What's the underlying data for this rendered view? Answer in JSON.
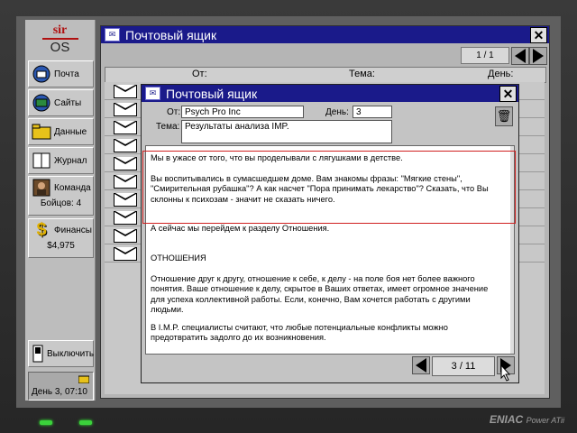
{
  "logo": {
    "top": "sir",
    "bottom": "OS"
  },
  "sidebar": {
    "mail": "Почта",
    "sites": "Сайты",
    "data": "Данные",
    "journal": "Журнал",
    "team": "Команда",
    "fighters": "Бойцов: 4",
    "finance": "Финансы",
    "money": "$4,975",
    "shutdown": "Выключить",
    "clock": "День 3, 07:10"
  },
  "mailbox": {
    "title": "Почтовый ящик",
    "page": "1 / 1",
    "col_from": "От:",
    "col_subject": "Тема:",
    "col_day": "День:"
  },
  "message": {
    "title": "Почтовый ящик",
    "from_label": "От:",
    "from_value": "Psych Pro Inc",
    "day_label": "День:",
    "day_value": "3",
    "subject_label": "Тема:",
    "subject_value": "Результаты анализа IMP.",
    "paragraphs": [
      "Мы в ужасе от того, что вы проделывали с лягушками в детстве.",
      "Вы воспитывались в сумасшедшем доме. Вам знакомы фразы: \"Мягкие стены\", \"Смирительная рубашка\"? А как насчет \"Пора принимать лекарство\"? Сказать, что Вы склонны к психозам - значит не сказать ничего.",
      "А сейчас мы перейдем к разделу Отношения.",
      "ОТНОШЕНИЯ",
      "Отношение друг к другу, отношение к себе, к делу - на поле боя нет более важного понятия. Ваше отношение к делу, скрытое в Ваших ответах, имеет огромное значение для успеха коллективной работы. Если, конечно, Вам хочется работать с другими людьми.",
      "В I.M.P. специалисты считают, что любые потенциальные конфликты можно предотвратить задолго до их возникновения."
    ],
    "page": "3 / 11"
  },
  "brand": {
    "name": "ENIAC",
    "model": "Power ATii"
  }
}
